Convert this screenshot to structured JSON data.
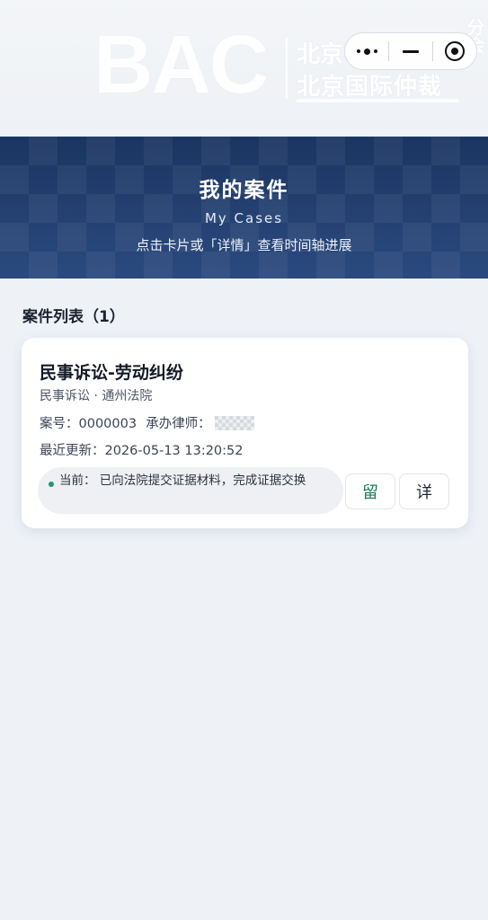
{
  "navbar": {
    "logo_text": "BAC",
    "logo_cn_top": "北京",
    "logo_cn": "北京国际仲裁",
    "logo_side": "分会",
    "capsule": {
      "more_icon": "more-dots-icon",
      "minimize_icon": "minimize-icon",
      "close_icon": "target-close-icon"
    }
  },
  "hero": {
    "title": "我的案件",
    "subtitle": "My Cases",
    "hint": "点击卡片或「详情」查看时间轴进展"
  },
  "list": {
    "title": "案件列表（1）",
    "cases": [
      {
        "title": "民事诉讼-劳动纠纷",
        "meta": "民事诉讼 · 通州法院",
        "case_no": "案号：0000003",
        "lawyer_label": "承办律师：",
        "updated": "最近更新：2026-05-13 13:20:52",
        "status": "当前： 已向法院提交证据材料，完成证据交换",
        "status_color": "#1f9a6b",
        "message_button": "留",
        "detail_button": "详"
      }
    ]
  }
}
